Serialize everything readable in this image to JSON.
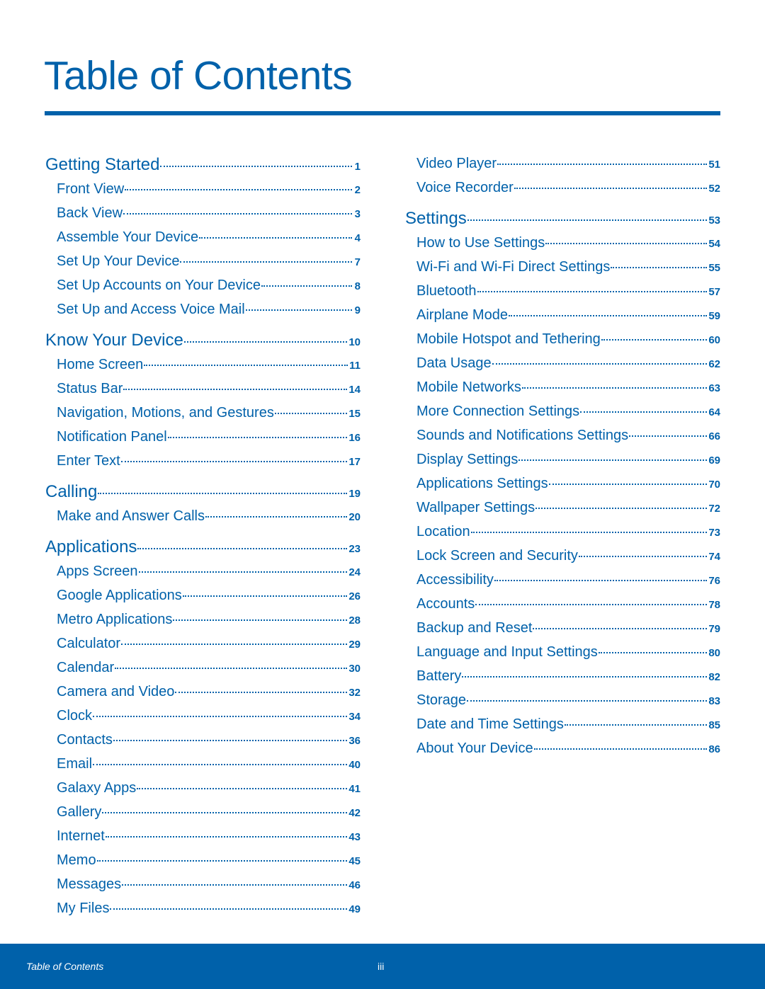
{
  "title": "Table of Contents",
  "colors": {
    "accent": "#0061aa"
  },
  "left_column": [
    {
      "type": "section",
      "label": "Getting Started",
      "page": "1"
    },
    {
      "type": "item",
      "label": "Front View",
      "page": "2"
    },
    {
      "type": "item",
      "label": "Back View",
      "page": "3"
    },
    {
      "type": "item",
      "label": "Assemble Your Device",
      "page": "4"
    },
    {
      "type": "item",
      "label": "Set Up Your Device",
      "page": "7"
    },
    {
      "type": "item",
      "label": "Set Up Accounts on Your Device",
      "page": "8"
    },
    {
      "type": "item",
      "label": "Set Up and Access Voice Mail",
      "page": "9"
    },
    {
      "type": "section",
      "label": "Know Your Device",
      "page": "10"
    },
    {
      "type": "item",
      "label": "Home Screen",
      "page": "11"
    },
    {
      "type": "item",
      "label": "Status Bar",
      "page": "14"
    },
    {
      "type": "item",
      "label": "Navigation, Motions, and Gestures",
      "page": "15"
    },
    {
      "type": "item",
      "label": "Notification Panel",
      "page": "16"
    },
    {
      "type": "item",
      "label": "Enter Text",
      "page": "17"
    },
    {
      "type": "section",
      "label": "Calling",
      "page": "19"
    },
    {
      "type": "item",
      "label": "Make and Answer Calls",
      "page": "20"
    },
    {
      "type": "section",
      "label": "Applications",
      "page": "23"
    },
    {
      "type": "item",
      "label": "Apps Screen",
      "page": "24"
    },
    {
      "type": "item",
      "label": "Google Applications",
      "page": "26"
    },
    {
      "type": "item",
      "label": "Metro Applications",
      "page": "28"
    },
    {
      "type": "item",
      "label": "Calculator",
      "page": "29"
    },
    {
      "type": "item",
      "label": "Calendar",
      "page": "30"
    },
    {
      "type": "item",
      "label": "Camera and Video",
      "page": "32"
    },
    {
      "type": "item",
      "label": "Clock",
      "page": "34"
    },
    {
      "type": "item",
      "label": "Contacts",
      "page": "36"
    },
    {
      "type": "item",
      "label": "Email",
      "page": "40"
    },
    {
      "type": "item",
      "label": "Galaxy Apps",
      "page": "41"
    },
    {
      "type": "item",
      "label": "Gallery",
      "page": "42"
    },
    {
      "type": "item",
      "label": "Internet",
      "page": "43"
    },
    {
      "type": "item",
      "label": "Memo",
      "page": "45"
    },
    {
      "type": "item",
      "label": "Messages",
      "page": "46"
    },
    {
      "type": "item",
      "label": "My Files",
      "page": "49"
    }
  ],
  "right_column": [
    {
      "type": "item",
      "label": "Video Player",
      "page": "51"
    },
    {
      "type": "item",
      "label": "Voice Recorder",
      "page": "52"
    },
    {
      "type": "section",
      "label": "Settings",
      "page": "53"
    },
    {
      "type": "item",
      "label": "How to Use Settings",
      "page": "54"
    },
    {
      "type": "item",
      "label": "Wi-Fi and Wi-Fi Direct Settings",
      "page": "55"
    },
    {
      "type": "item",
      "label": "Bluetooth",
      "page": "57"
    },
    {
      "type": "item",
      "label": "Airplane Mode",
      "page": "59"
    },
    {
      "type": "item",
      "label": "Mobile Hotspot and Tethering",
      "page": "60"
    },
    {
      "type": "item",
      "label": "Data Usage",
      "page": "62"
    },
    {
      "type": "item",
      "label": "Mobile Networks",
      "page": "63"
    },
    {
      "type": "item",
      "label": "More Connection Settings",
      "page": "64"
    },
    {
      "type": "item",
      "label": "Sounds and Notifications Settings",
      "page": "66"
    },
    {
      "type": "item",
      "label": "Display Settings",
      "page": "69"
    },
    {
      "type": "item",
      "label": "Applications Settings",
      "page": "70"
    },
    {
      "type": "item",
      "label": "Wallpaper Settings",
      "page": "72"
    },
    {
      "type": "item",
      "label": "Location",
      "page": "73"
    },
    {
      "type": "item",
      "label": "Lock Screen and Security",
      "page": "74"
    },
    {
      "type": "item",
      "label": "Accessibility",
      "page": "76"
    },
    {
      "type": "item",
      "label": "Accounts",
      "page": "78"
    },
    {
      "type": "item",
      "label": "Backup and Reset",
      "page": "79"
    },
    {
      "type": "item",
      "label": "Language and Input Settings",
      "page": "80"
    },
    {
      "type": "item",
      "label": "Battery",
      "page": "82"
    },
    {
      "type": "item",
      "label": "Storage",
      "page": "83"
    },
    {
      "type": "item",
      "label": "Date and Time Settings",
      "page": "85"
    },
    {
      "type": "item",
      "label": "About Your Device",
      "page": "86"
    }
  ],
  "footer": {
    "section": "Table of Contents",
    "page": "iii"
  }
}
